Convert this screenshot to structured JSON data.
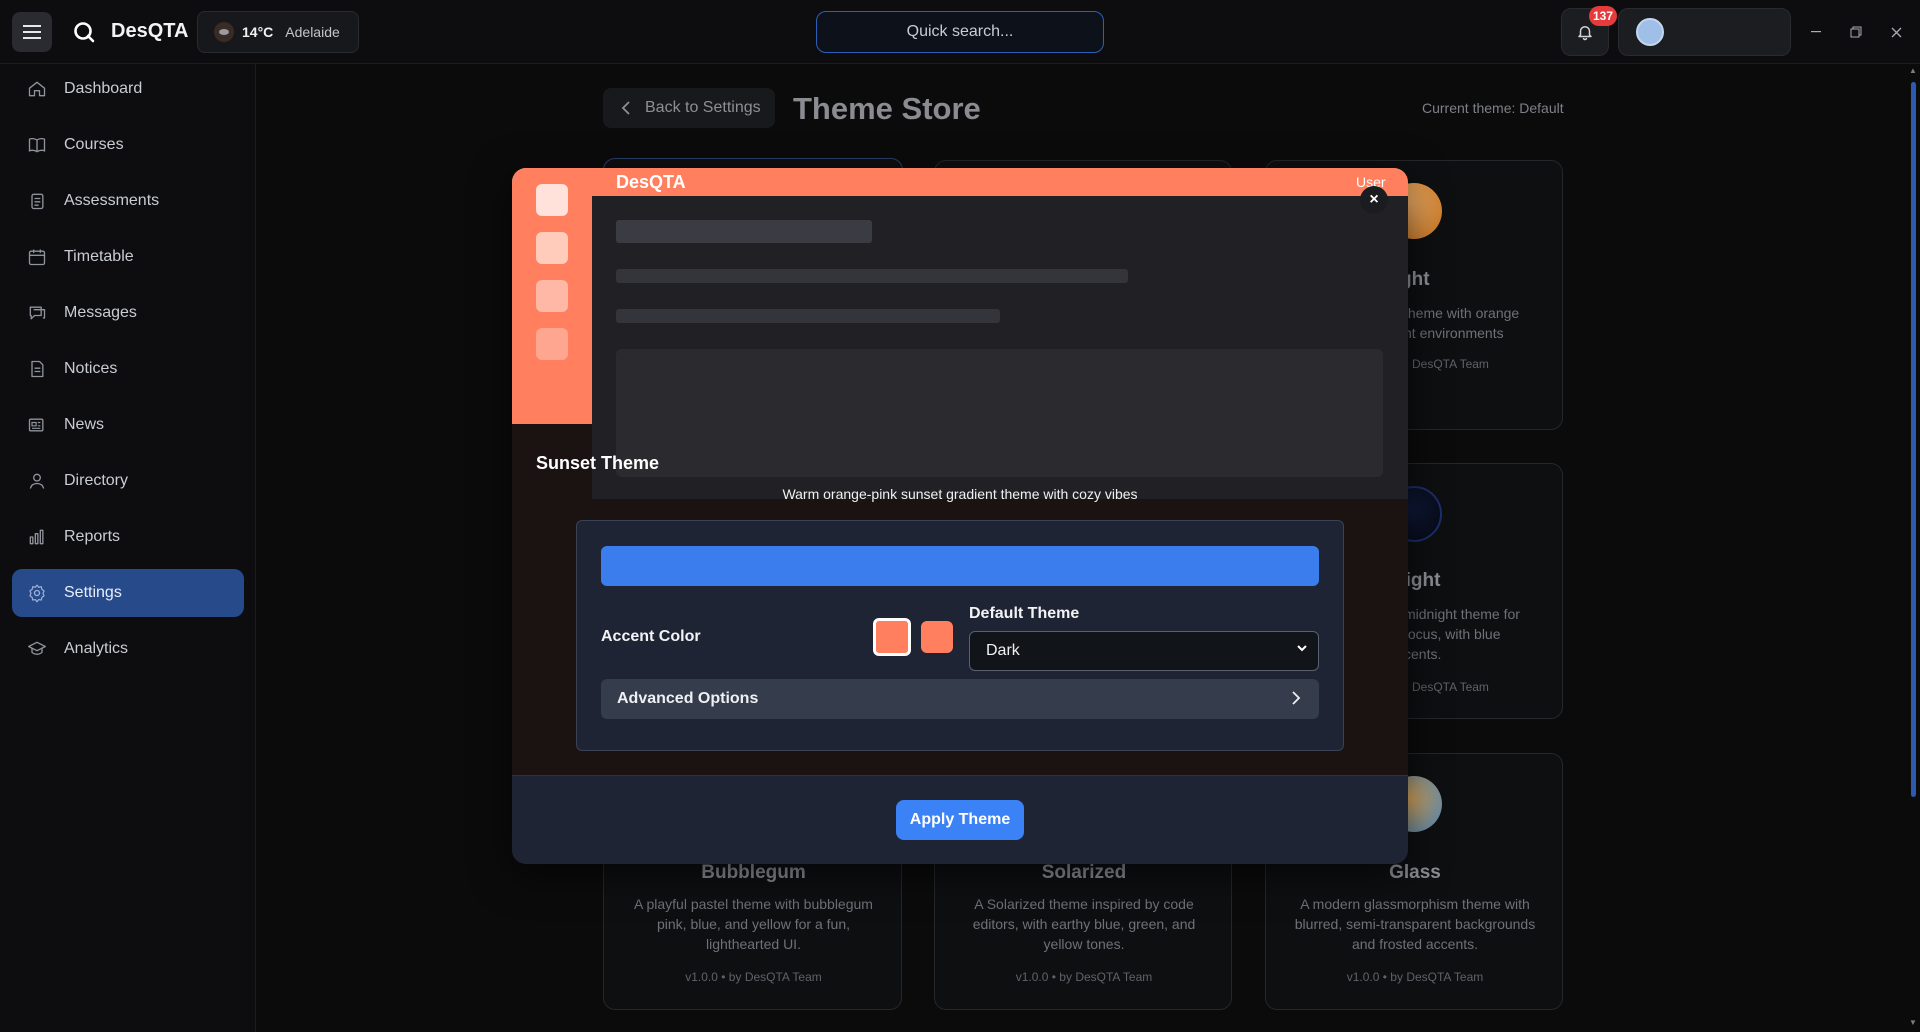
{
  "topbar": {
    "app_name": "DesQTA",
    "weather": {
      "temperature": "14°C",
      "location": "Adelaide"
    },
    "search_placeholder": "Quick search...",
    "notification_count": "137"
  },
  "sidebar": {
    "items": [
      {
        "label": "Dashboard",
        "icon": "home-icon"
      },
      {
        "label": "Courses",
        "icon": "book-icon"
      },
      {
        "label": "Assessments",
        "icon": "clipboard-icon"
      },
      {
        "label": "Timetable",
        "icon": "calendar-icon"
      },
      {
        "label": "Messages",
        "icon": "chat-icon"
      },
      {
        "label": "Notices",
        "icon": "document-icon"
      },
      {
        "label": "News",
        "icon": "newspaper-icon"
      },
      {
        "label": "Directory",
        "icon": "user-icon"
      },
      {
        "label": "Reports",
        "icon": "bar-chart-icon"
      },
      {
        "label": "Settings",
        "icon": "gear-icon",
        "active": true
      },
      {
        "label": "Analytics",
        "icon": "graduation-cap-icon"
      }
    ]
  },
  "page": {
    "back_label": "Back to Settings",
    "title": "Theme Store",
    "current_theme": "Current theme: Default"
  },
  "cards": {
    "right_top": {
      "title_fragment": "ght",
      "desc_line1": "theme with orange",
      "desc_line2": "ht environments",
      "meta": "DesQTA Team"
    },
    "right_mid": {
      "title_fragment": "night",
      "desc_line1": "midnight theme for",
      "desc_line2": "focus, with blue",
      "desc_line3": "cents.",
      "meta": "DesQTA Team"
    },
    "bubblegum": {
      "title": "Bubblegum",
      "desc": "A playful pastel theme with bubblegum pink, blue, and yellow for a fun, lighthearted UI.",
      "meta": "v1.0.0  •  by DesQTA Team"
    },
    "solarized": {
      "title": "Solarized",
      "desc": "A Solarized theme inspired by code editors, with earthy blue, green, and yellow tones.",
      "meta": "v1.0.0  •  by DesQTA Team"
    },
    "glass": {
      "title": "Glass",
      "desc": "A modern glassmorphism theme with blurred, semi-transparent backgrounds and frosted accents.",
      "meta": "v1.0.0  •  by DesQTA Team"
    }
  },
  "modal": {
    "preview_brand": "DesQTA",
    "preview_user": "User",
    "close_symbol": "×",
    "theme_name": "Sunset Theme",
    "theme_description": "Warm orange-pink sunset gradient theme with cozy vibes",
    "accent_label": "Accent Color",
    "default_theme_label": "Default Theme",
    "default_theme_value": "Dark",
    "advanced_label": "Advanced Options",
    "apply_label": "Apply Theme",
    "colors": {
      "accent": "#ff7f5f",
      "primary": "#3b7ded"
    }
  }
}
